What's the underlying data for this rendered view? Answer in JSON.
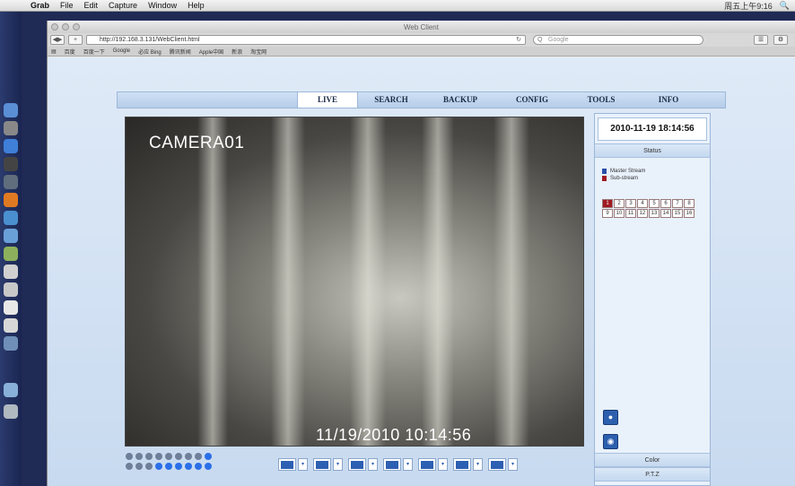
{
  "menubar": {
    "app": "Grab",
    "items": [
      "File",
      "Edit",
      "Capture",
      "Window",
      "Help"
    ],
    "right_text": "周五上午9:16"
  },
  "window": {
    "title": "Web Client",
    "url": "http://192.168.3.131/WebClient.html",
    "search_placeholder": "Google",
    "bookmarks": [
      "百度",
      "百度一下",
      "Google",
      "必应 Bing",
      "腾讯新闻",
      "Apple中国",
      "新浪",
      "淘宝网"
    ]
  },
  "app": {
    "tabs": [
      "LIVE",
      "SEARCH",
      "BACKUP",
      "CONFIG",
      "TOOLS",
      "INFO"
    ],
    "active_tab": "LIVE",
    "camera_label": "CAMERA01",
    "camera_timestamp": "11/19/2010 10:14:56",
    "datetime": "2010-11-19 18:14:56",
    "status_label": "Status",
    "legend": [
      {
        "label": "Master Stream",
        "color": "#2a4fa8"
      },
      {
        "label": "Sub-stream",
        "color": "#a01a22"
      }
    ],
    "channels": [
      "1",
      "2",
      "3",
      "4",
      "5",
      "6",
      "7",
      "8",
      "9",
      "10",
      "11",
      "12",
      "13",
      "14",
      "15",
      "16"
    ],
    "active_channel": "1",
    "color_label": "Color",
    "ptz_label": "P.T.Z",
    "accent_color": "#2d5fb2"
  }
}
